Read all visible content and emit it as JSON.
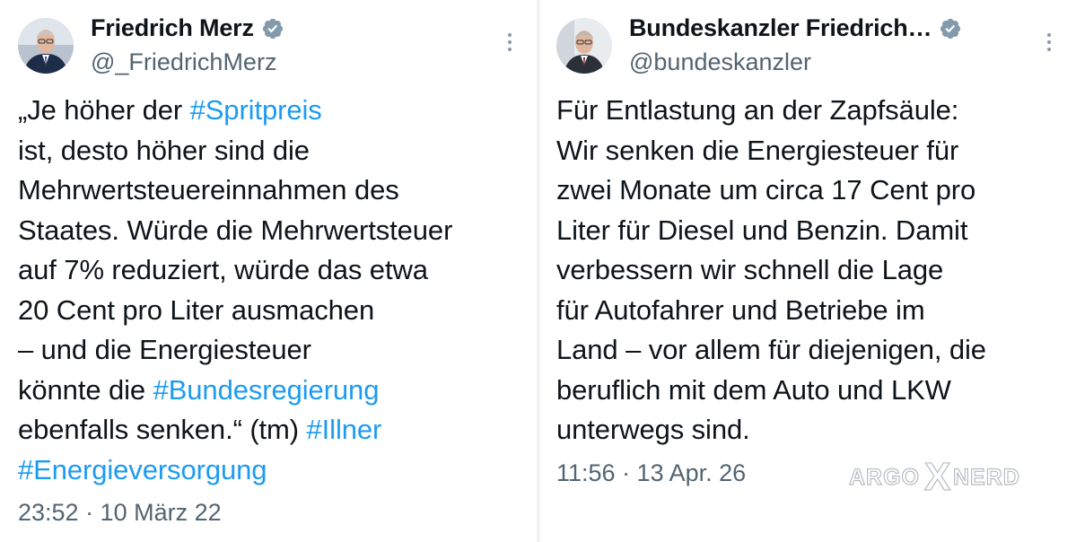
{
  "tweets": [
    {
      "author": {
        "display_name": "Friedrich Merz",
        "handle": "@_FriedrichMerz",
        "verified": true,
        "avatar": "portrait-photo"
      },
      "body_lines": [
        [
          {
            "text": "„Je höher der "
          },
          {
            "text": "#Spritpreis",
            "hashtag": true
          }
        ],
        [
          {
            "text": "ist, desto höher sind die"
          }
        ],
        [
          {
            "text": "Mehrwertsteuereinnahmen des"
          }
        ],
        [
          {
            "text": "Staates. Würde die Mehrwertsteuer"
          }
        ],
        [
          {
            "text": "auf 7% reduziert, würde das etwa"
          }
        ],
        [
          {
            "text": "20 Cent pro Liter ausmachen"
          }
        ],
        [
          {
            "text": "– und die Energiesteuer"
          }
        ],
        [
          {
            "text": "könnte die "
          },
          {
            "text": "#Bundesregierung",
            "hashtag": true
          }
        ],
        [
          {
            "text": "ebenfalls senken.“ (tm) "
          },
          {
            "text": "#Illner",
            "hashtag": true
          }
        ],
        [
          {
            "text": "#Energieversorgung",
            "hashtag": true
          }
        ]
      ],
      "timestamp": "23:52 · 10 März 22"
    },
    {
      "author": {
        "display_name": "Bundeskanzler Friedrich…",
        "handle": "@bundeskanzler",
        "verified": true,
        "avatar": "portrait-photo"
      },
      "body_lines": [
        [
          {
            "text": "Für Entlastung an der Zapfsäule:"
          }
        ],
        [
          {
            "text": "Wir senken die Energiesteuer für"
          }
        ],
        [
          {
            "text": "zwei Monate um circa 17 Cent pro"
          }
        ],
        [
          {
            "text": "Liter für Diesel und Benzin. Damit"
          }
        ],
        [
          {
            "text": "verbessern wir schnell die Lage"
          }
        ],
        [
          {
            "text": "für Autofahrer und Betriebe im"
          }
        ],
        [
          {
            "text": "Land – vor allem für diejenigen, die"
          }
        ],
        [
          {
            "text": "beruflich mit dem Auto und LKW"
          }
        ],
        [
          {
            "text": "unterwegs sind."
          }
        ]
      ],
      "timestamp": "11:56 · 13 Apr. 26"
    }
  ],
  "watermark": {
    "left": "ARGO",
    "mark": "X",
    "right": "NERD"
  },
  "icons": {
    "verified": "verified-badge-icon",
    "more": "more-options-icon"
  },
  "colors": {
    "hashtag": "#1d9bf0",
    "secondary_text": "#536471",
    "verified_badge": "#829aab"
  }
}
